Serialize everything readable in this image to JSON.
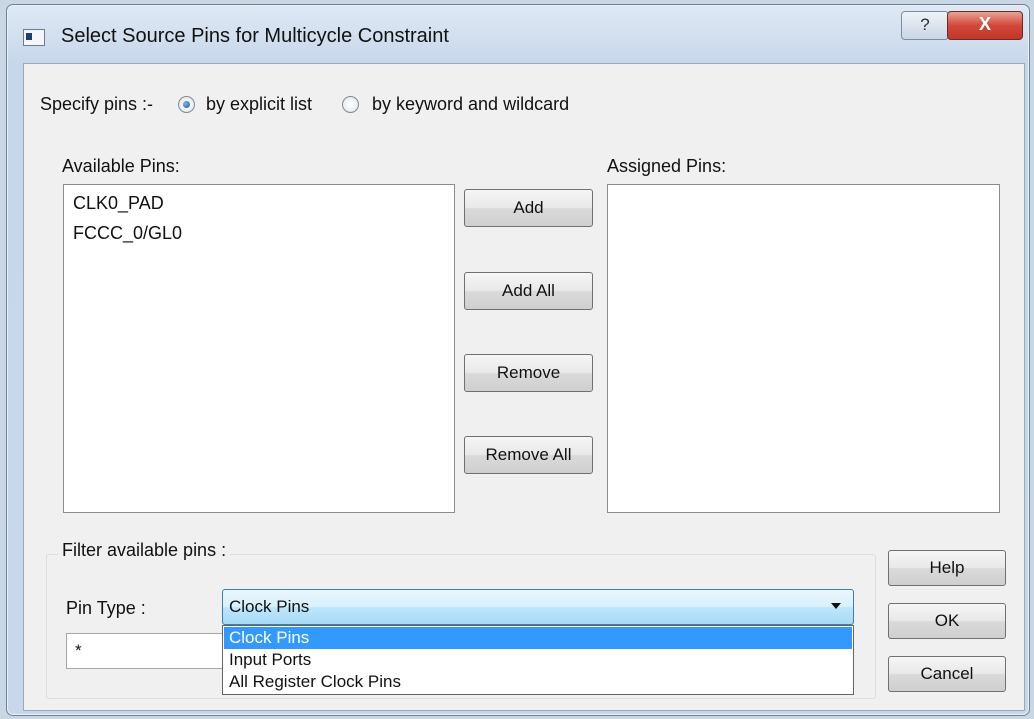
{
  "window": {
    "title": "Select Source Pins for Multicycle Constraint",
    "help_glyph": "?",
    "close_glyph": "X"
  },
  "specify": {
    "label": "Specify pins :-",
    "options": [
      {
        "label": "by explicit list",
        "checked": true
      },
      {
        "label": "by keyword and wildcard",
        "checked": false
      }
    ]
  },
  "available": {
    "label": "Available Pins:",
    "items": [
      "CLK0_PAD",
      "FCCC_0/GL0"
    ]
  },
  "assigned": {
    "label": "Assigned Pins:",
    "items": []
  },
  "actions": {
    "add": "Add",
    "add_all": "Add All",
    "remove": "Remove",
    "remove_all": "Remove All"
  },
  "filter": {
    "group_label": "Filter available pins :",
    "pin_type_label": "Pin Type :",
    "pin_type_value": "Clock Pins",
    "pin_type_options": [
      "Clock Pins",
      "Input Ports",
      "All Register Clock Pins"
    ],
    "pattern_value": "*"
  },
  "dialog_buttons": {
    "help": "Help",
    "ok": "OK",
    "cancel": "Cancel"
  },
  "colors": {
    "selection": "#3399ff",
    "close_button": "#c9473a",
    "combo_focus_border": "#3c7fb1"
  }
}
